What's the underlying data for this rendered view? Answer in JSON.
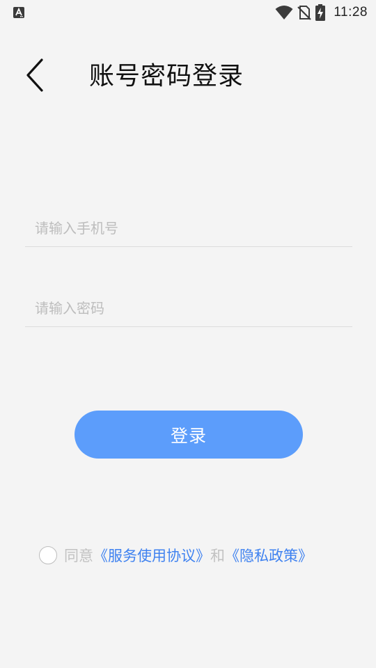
{
  "status_bar": {
    "time": "11:28",
    "icons": [
      "app-notification-icon",
      "wifi-icon",
      "no-sim-icon",
      "battery-charging-icon"
    ]
  },
  "header": {
    "title": "账号密码登录",
    "back_icon": "chevron-left-icon"
  },
  "form": {
    "phone_placeholder": "请输入手机号",
    "phone_value": "",
    "password_placeholder": "请输入密码",
    "password_value": ""
  },
  "login_button": {
    "label": "登录"
  },
  "agreement": {
    "checked": false,
    "prefix": "同意",
    "service_link": "《服务使用协议》",
    "connector": "和",
    "privacy_link": "《隐私政策》"
  },
  "colors": {
    "background": "#f4f4f4",
    "accent": "#5c9dfb",
    "link": "#3f82f0",
    "placeholder": "#bdbdbd"
  }
}
